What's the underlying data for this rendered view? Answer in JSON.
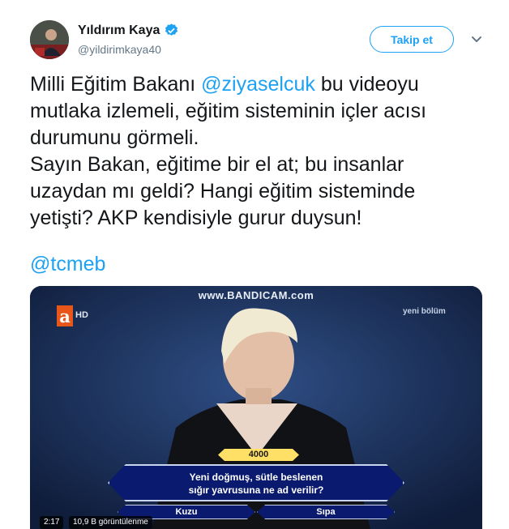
{
  "author": {
    "name": "Yıldırım Kaya",
    "handle": "@yildirimkaya40",
    "verified": true
  },
  "follow_button": {
    "label": "Takip et"
  },
  "more_menu": {
    "icon": "chevron-down-icon"
  },
  "tweet": {
    "lines": [
      {
        "before": "Milli Eğitim Bakanı ",
        "mention": "@ziyaselcuk",
        "after": " bu videoyu"
      },
      {
        "text": "mutlaka izlemeli, eğitim sisteminin içler acısı"
      },
      {
        "text": "durumunu görmeli."
      },
      {
        "text": "Sayın Bakan, eğitime bir el at; bu insanlar"
      },
      {
        "text": "uzaydan mı geldi? Hangi eğitim sisteminde"
      },
      {
        "text": "yetişti? AKP kendisiyle gurur duysun!"
      }
    ],
    "tag": "@tcmeb"
  },
  "video": {
    "watermark": "www.BANDICAM.com",
    "channel_logo": "a",
    "channel_hd": "HD",
    "new_episode": "yeni bölüm",
    "prize": "4000",
    "question_line1": "Yeni doğmuş, sütle beslenen",
    "question_line2": "sığır yavrusuna ne ad verilir?",
    "answer_a": "Kuzu",
    "answer_b": "Sıpa",
    "duration": "2:17",
    "views": "10,9 B görüntülenme"
  },
  "colors": {
    "accent": "#1da1f2",
    "text": "#14171a",
    "secondary": "#657786"
  }
}
